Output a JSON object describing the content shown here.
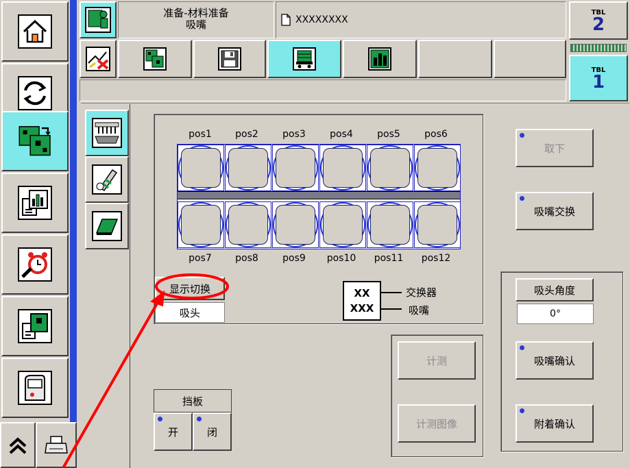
{
  "header": {
    "title_line1": "准备-材料准备",
    "title_line2": "吸嘴",
    "file_name": "XXXXXXXX",
    "tbl_top": {
      "label": "TBL",
      "number": "2"
    },
    "tbl_bottom": {
      "label": "TBL",
      "number": "1"
    }
  },
  "positions_top": [
    "pos1",
    "pos2",
    "pos3",
    "pos4",
    "pos5",
    "pos6"
  ],
  "positions_bottom": [
    "pos7",
    "pos8",
    "pos9",
    "pos10",
    "pos11",
    "pos12"
  ],
  "display_switch": {
    "label": "显示切换",
    "value": "吸头"
  },
  "legend": {
    "box_top": "XX",
    "box_bottom": "XXX",
    "label_top": "交换器",
    "label_bottom": "吸嘴"
  },
  "shutter": {
    "title": "挡板",
    "open": "开",
    "close": "闭"
  },
  "measure": {
    "button": "计测",
    "image_button": "计测图像"
  },
  "actions": {
    "remove": "取下",
    "nozzle_exchange": "吸嘴交换",
    "nozzle_confirm": "吸嘴确认",
    "attach_confirm": "附着确认"
  },
  "head_angle": {
    "label": "吸头角度",
    "value": "0°"
  },
  "colors": {
    "accent_cyan": "#7fe8e8",
    "sidebar_blue": "#2a48d8",
    "panel_gray": "#d4d0c8",
    "annotation_red": "#ff0000"
  }
}
